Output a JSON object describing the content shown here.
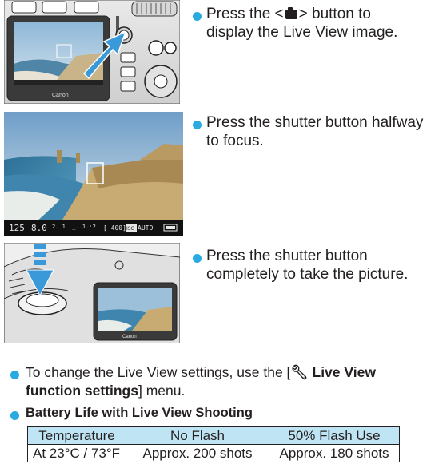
{
  "steps": [
    {
      "text_line1_prefix": "Press the <",
      "button_icon": "live-view-camera-icon",
      "text_line1_suffix": "> button to",
      "text_line2": "display the Live View image."
    },
    {
      "text_line1": "Press the shutter button halfway",
      "text_line2": "to focus."
    },
    {
      "text_line1": "Press the shutter button",
      "text_line2": "completely to take the picture."
    }
  ],
  "images": {
    "camera_brand": "Canon",
    "lcd_status": {
      "shutter": "125",
      "aperture": "8.0",
      "exposure_scale": "2..1..̲..1.:2",
      "shots": "[ 400]",
      "iso": "ISO",
      "iso_value": "AUTO"
    }
  },
  "notes": {
    "settings_prefix": "To change the Live View settings, use the [",
    "settings_icon": "wrench-icon",
    "settings_bold": " Live View",
    "settings_bold2": "function settings",
    "settings_suffix": "] menu.",
    "battery_heading": "Battery Life with Live View Shooting"
  },
  "battery_table": {
    "headers": [
      "Temperature",
      "No Flash",
      "50% Flash Use"
    ],
    "row": [
      "At 23°C / 73°F",
      "Approx. 200 shots",
      "Approx. 180 shots"
    ]
  },
  "colors": {
    "bullet": "#29abe2",
    "table_header": "#bfe5f5"
  }
}
